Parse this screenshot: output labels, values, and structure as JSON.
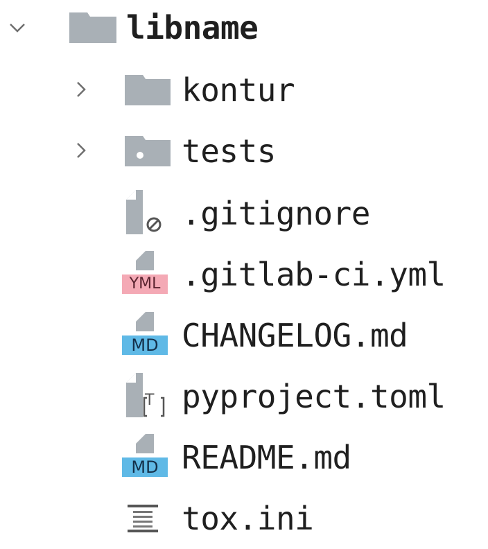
{
  "tree": {
    "root": {
      "label": "libname",
      "icon": "folder-icon",
      "expanded": true
    },
    "children": [
      {
        "label": "kontur",
        "icon": "folder-icon",
        "expandable": true,
        "expanded": false
      },
      {
        "label": "tests",
        "icon": "test-folder-icon",
        "expandable": true,
        "expanded": false
      },
      {
        "label": ".gitignore",
        "icon": "ignore-file-icon"
      },
      {
        "label": ".gitlab-ci.yml",
        "icon": "yml-file-icon",
        "badge": "YML",
        "badge_color": "#f4a9b5"
      },
      {
        "label": "CHANGELOG.md",
        "icon": "markdown-file-icon",
        "badge": "MD",
        "badge_color": "#5fb9e6"
      },
      {
        "label": "pyproject.toml",
        "icon": "toml-file-icon",
        "badge": "T"
      },
      {
        "label": "README.md",
        "icon": "markdown-file-icon",
        "badge": "MD",
        "badge_color": "#5fb9e6"
      },
      {
        "label": "tox.ini",
        "icon": "ini-file-icon"
      }
    ]
  },
  "colors": {
    "icon_gray": "#a9b0b6",
    "text": "#1f1f1f",
    "chevron": "#6e6e6e"
  }
}
